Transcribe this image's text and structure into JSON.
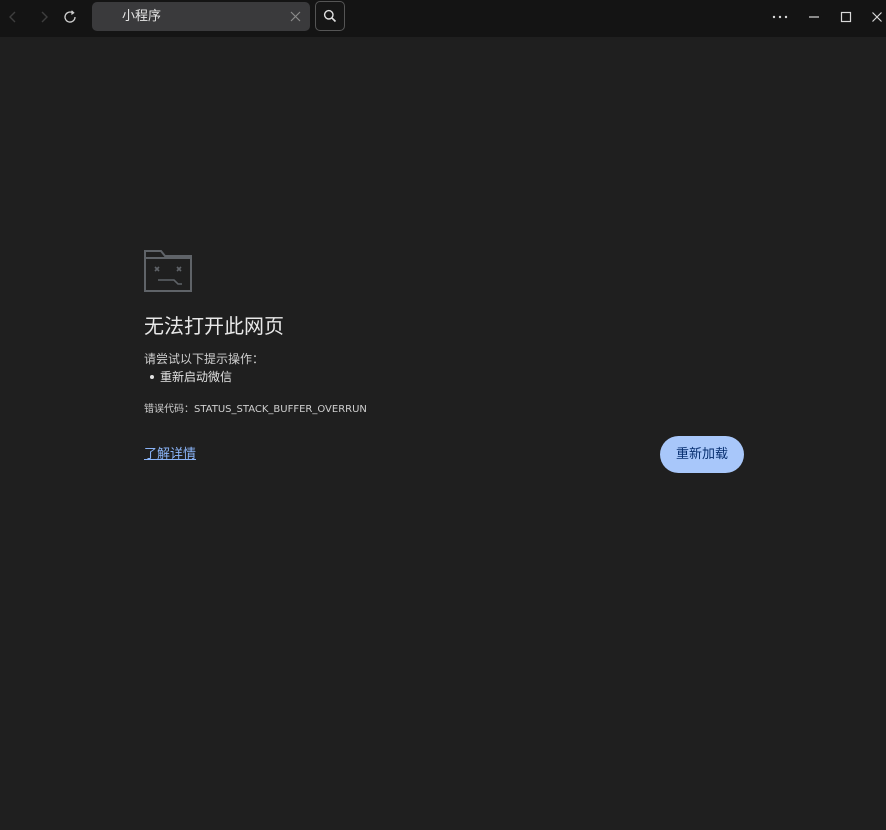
{
  "toolbar": {
    "address": "小程序",
    "back_icon": "chevron-left-icon",
    "forward_icon": "chevron-right-icon",
    "reload_icon": "refresh-icon",
    "search_icon": "search-icon",
    "more_icon": "more-horizontal-icon",
    "minimize_icon": "minimize-icon",
    "maximize_icon": "maximize-icon",
    "close_icon": "close-icon"
  },
  "error_page": {
    "title": "无法打开此网页",
    "suggest_heading": "请尝试以下提示操作：",
    "suggestions": [
      "重新启动微信"
    ],
    "error_code": "错误代码：STATUS_STACK_BUFFER_OVERRUN",
    "learn_more": "了解详情",
    "reload_button": "重新加载",
    "icon": "sad-folder-icon"
  },
  "colors": {
    "background": "#1f1f1f",
    "toolbar": "#141414",
    "address_bar": "#3a3a3c",
    "link": "#8ab4f8",
    "button_bg": "#a8c7fa",
    "button_text": "#062e6f"
  }
}
